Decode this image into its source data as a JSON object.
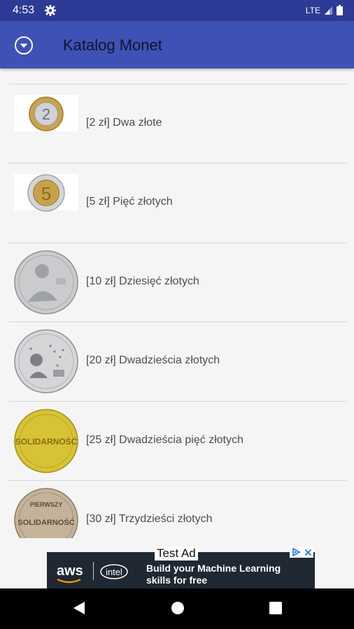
{
  "status_bar": {
    "time": "4:53",
    "network": "LTE"
  },
  "app_bar": {
    "title": "Katalog Monet"
  },
  "coins": [
    {
      "label": "[2 zł] Dwa złote"
    },
    {
      "label": "[5 zł] Pięć złotych"
    },
    {
      "label": "[10 zł] Dziesięć złotych"
    },
    {
      "label": "[20 zł] Dwadzieścia złotych"
    },
    {
      "label": "[25 zł] Dwadzieścia pięć złotych"
    },
    {
      "label": "[30 zł] Trzydzieści złotych"
    }
  ],
  "coin_art": {
    "c2": "2",
    "c5": "5",
    "c25": "SOLIDARNOŚĆ",
    "c30a": "PIERWSZY",
    "c30b": "SOLIDARNOŚĆ"
  },
  "ad": {
    "label": "Test Ad",
    "line1": "Build your Machine Learning",
    "line2": "skills for free",
    "brand1": "aws",
    "brand2": "intel"
  }
}
